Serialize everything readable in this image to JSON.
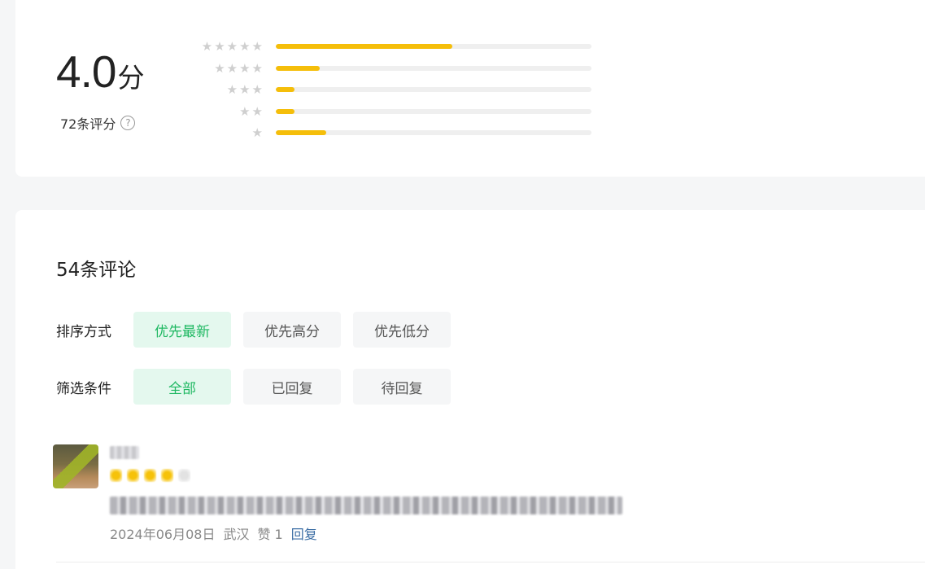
{
  "summary": {
    "score": "4.0",
    "score_unit": "分",
    "rating_count": "72条评分",
    "help_icon": "?"
  },
  "distribution": [
    {
      "stars": 5,
      "fraction": 0.56
    },
    {
      "stars": 4,
      "fraction": 0.14
    },
    {
      "stars": 3,
      "fraction": 0.06
    },
    {
      "stars": 2,
      "fraction": 0.06
    },
    {
      "stars": 1,
      "fraction": 0.16
    }
  ],
  "colors": {
    "accent_green": "#1fb862",
    "active_chip_bg": "#e4f8ee",
    "bar_fill": "#f5be0a",
    "star_gray": "#cfcfcf",
    "link": "#3c6ea5"
  },
  "reviews_section": {
    "title": "54条评论",
    "sort": {
      "label": "排序方式",
      "options": [
        "优先最新",
        "优先高分",
        "优先低分"
      ],
      "selected": "优先最新"
    },
    "filter": {
      "label": "筛选条件",
      "options": [
        "全部",
        "已回复",
        "待回复"
      ],
      "selected": "全部"
    }
  },
  "review": {
    "rating": 4,
    "date": "2024年06月08日",
    "location": "武汉",
    "likes": "赞 1",
    "reply_label": "回复"
  }
}
